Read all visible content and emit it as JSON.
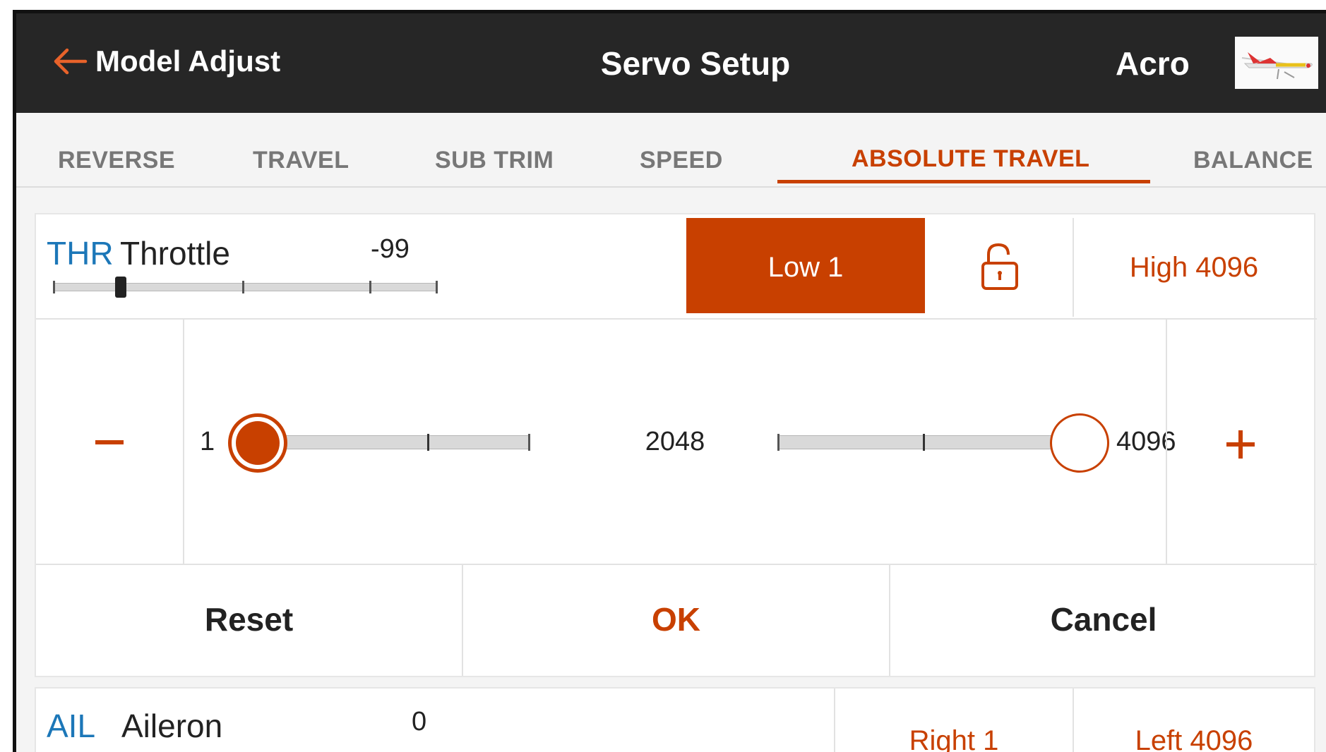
{
  "header": {
    "back_label": "Model Adjust",
    "title": "Servo Setup",
    "model_name": "Acro"
  },
  "tabs": [
    {
      "label": "REVERSE",
      "active": false
    },
    {
      "label": "TRAVEL",
      "active": false
    },
    {
      "label": "SUB TRIM",
      "active": false
    },
    {
      "label": "SPEED",
      "active": false
    },
    {
      "label": "ABSOLUTE TRAVEL",
      "active": true
    },
    {
      "label": "BALANCE",
      "active": false
    }
  ],
  "throttle": {
    "code": "THR",
    "name": "Throttle",
    "value": "-99",
    "low_button": "Low 1",
    "high_button": "High 4096",
    "lock_icon": "unlock-icon"
  },
  "editor": {
    "minus": "−",
    "plus": "+",
    "min_label": "1",
    "mid_label": "2048",
    "max_label": "4096",
    "low_value": 1,
    "high_value": 4096,
    "range_max": 4096
  },
  "actions": {
    "reset": "Reset",
    "ok": "OK",
    "cancel": "Cancel"
  },
  "aileron": {
    "code": "AIL",
    "name": "Aileron",
    "value": "0",
    "right_button": "Right 1",
    "left_button": "Left 4096"
  },
  "colors": {
    "accent": "#c84000",
    "header_bg": "#262626",
    "channel_code": "#1c77b8"
  }
}
